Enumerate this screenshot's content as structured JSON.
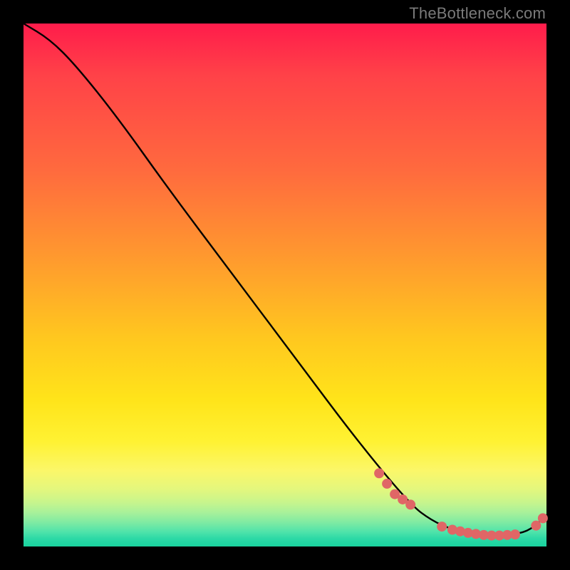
{
  "watermark": "TheBottleneck.com",
  "chart_data": {
    "type": "line",
    "title": "",
    "xlabel": "",
    "ylabel": "",
    "xlim": [
      0,
      100
    ],
    "ylim": [
      0,
      100
    ],
    "grid": false,
    "legend": false,
    "series": [
      {
        "name": "curve",
        "color": "#000000",
        "x": [
          0,
          5,
          10,
          18,
          28,
          40,
          52,
          64,
          74,
          78,
          82,
          86,
          90,
          94,
          97,
          100
        ],
        "values": [
          100,
          97,
          92,
          82,
          68,
          52,
          36,
          20,
          8,
          5,
          3.2,
          2.4,
          2.1,
          2.3,
          3.2,
          6
        ]
      }
    ],
    "markers": [
      {
        "name": "upper-cluster",
        "color": "#e06666",
        "points": [
          {
            "x": 68,
            "y": 14.0
          },
          {
            "x": 69.5,
            "y": 12.0
          },
          {
            "x": 71,
            "y": 10.0
          },
          {
            "x": 72.5,
            "y": 9.0
          },
          {
            "x": 74,
            "y": 8.0
          }
        ]
      },
      {
        "name": "bottom-cluster",
        "color": "#e06666",
        "points": [
          {
            "x": 80,
            "y": 3.8
          },
          {
            "x": 82,
            "y": 3.2
          },
          {
            "x": 83.5,
            "y": 2.9
          },
          {
            "x": 85,
            "y": 2.6
          },
          {
            "x": 86.5,
            "y": 2.4
          },
          {
            "x": 88,
            "y": 2.2
          },
          {
            "x": 89.5,
            "y": 2.1
          },
          {
            "x": 91,
            "y": 2.1
          },
          {
            "x": 92.5,
            "y": 2.2
          },
          {
            "x": 94,
            "y": 2.3
          }
        ]
      },
      {
        "name": "tail-cluster",
        "color": "#e06666",
        "points": [
          {
            "x": 98,
            "y": 4.0
          },
          {
            "x": 99.3,
            "y": 5.4
          }
        ]
      }
    ]
  }
}
